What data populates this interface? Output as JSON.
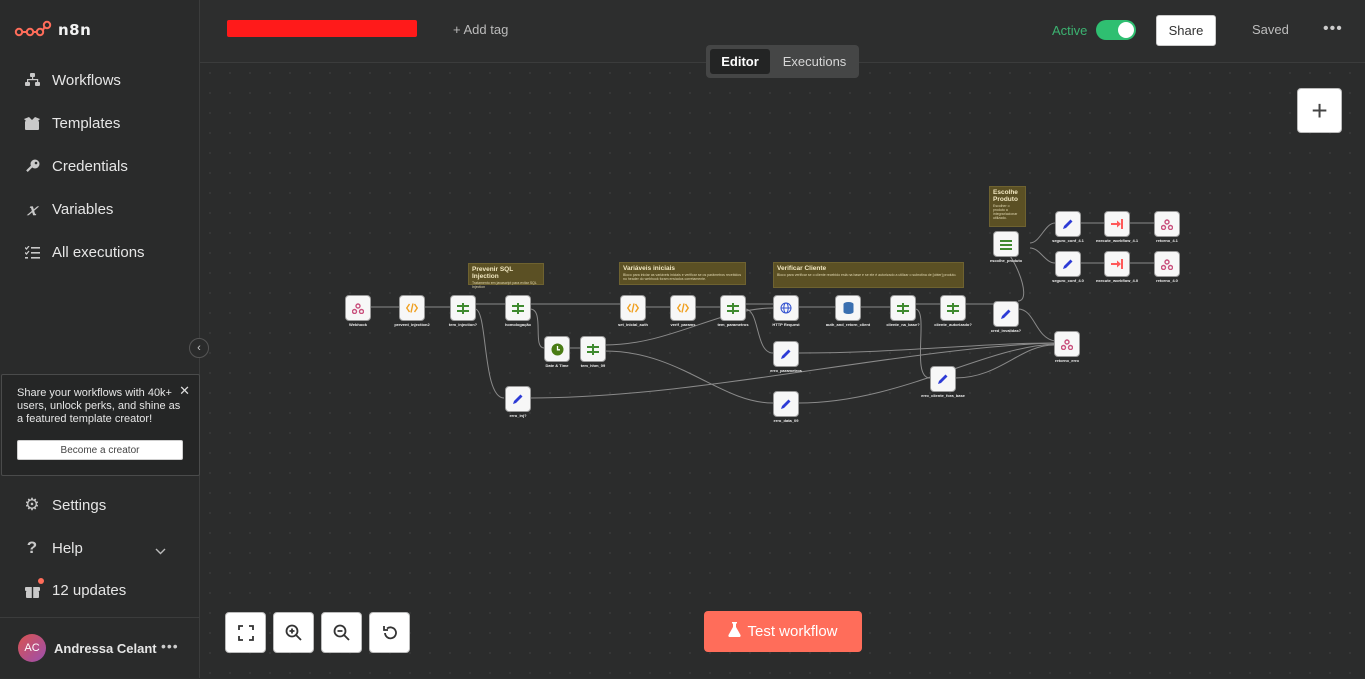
{
  "app": {
    "name": "n8n"
  },
  "sidebar": {
    "items": [
      {
        "label": "Workflows",
        "icon": "workflows-icon"
      },
      {
        "label": "Templates",
        "icon": "templates-icon"
      },
      {
        "label": "Credentials",
        "icon": "key-icon"
      },
      {
        "label": "Variables",
        "icon": "variables-icon"
      },
      {
        "label": "All executions",
        "icon": "list-icon"
      }
    ],
    "promo": {
      "text": "Share your workflows with 40k+ users, unlock perks, and shine as a featured template creator!",
      "button": "Become a creator"
    },
    "bottom": {
      "settings": "Settings",
      "help": "Help",
      "updates": "12 updates"
    },
    "user": {
      "initials": "AC",
      "name": "Andressa Celant"
    }
  },
  "header": {
    "add_tag": "+ Add tag",
    "active_label": "Active",
    "active": true,
    "share": "Share",
    "saved": "Saved",
    "accent_color": "#ff6d5a",
    "active_color": "#2fbf71"
  },
  "tabs": [
    {
      "label": "Editor",
      "selected": true
    },
    {
      "label": "Executions",
      "selected": false
    }
  ],
  "canvas": {
    "test_button": "Test workflow",
    "controls": [
      "fullscreen-icon",
      "zoom-in-icon",
      "zoom-out-icon",
      "reset-icon"
    ],
    "sticky_notes": [
      {
        "title": "Prevenir SQL Injection",
        "desc": "Tratamento em javascript para evitar SQL Injection"
      },
      {
        "title": "Variáveis iniciais",
        "desc": "Bloco para iniciar as variáveis iniciais e verificar se os parâmetros recebidos no header do webhook foram enviados corretamente."
      },
      {
        "title": "Verificar Cliente",
        "desc": "Bloco para verificar se o cliente recebido está na base e se ele é autorizado a utilizar o subrotina de [obter] produto."
      },
      {
        "title": "Escolhe Produto",
        "desc": "Escolher o produto a integrar/acionar utilizado."
      }
    ],
    "nodes": [
      {
        "label": "Webhook",
        "icon": "webhook-icon"
      },
      {
        "label": "prevent_injection2",
        "icon": "code-icon"
      },
      {
        "label": "tem_injection?",
        "icon": "if-icon"
      },
      {
        "label": "homologação",
        "icon": "if-icon"
      },
      {
        "label": "Date & Time",
        "icon": "clock-icon"
      },
      {
        "label": "tem_hhm_09",
        "icon": "if-icon"
      },
      {
        "label": "erro_inj?",
        "icon": "set-icon"
      },
      {
        "label": "set_inicial_auth",
        "icon": "code-icon"
      },
      {
        "label": "verif_params",
        "icon": "code-icon"
      },
      {
        "label": "tem_parametros",
        "icon": "if-icon"
      },
      {
        "label": "HTTP Request",
        "icon": "globe-icon"
      },
      {
        "label": "auth_and_retorn_client",
        "icon": "database-icon"
      },
      {
        "label": "cliente_na_base?",
        "icon": "if-icon"
      },
      {
        "label": "cliente_autorizado?",
        "icon": "if-icon"
      },
      {
        "label": "erro_parametros",
        "icon": "set-icon"
      },
      {
        "label": "erro_data_09",
        "icon": "set-icon"
      },
      {
        "label": "erro_cliente_fora_base",
        "icon": "set-icon"
      },
      {
        "label": "cred_invalidas?",
        "icon": "set-icon"
      },
      {
        "label": "escolhe_produto",
        "icon": "switch-icon"
      },
      {
        "label": "seguro_conf_4.1",
        "icon": "set-icon"
      },
      {
        "label": "execute_workflow_4.1",
        "icon": "execute-icon"
      },
      {
        "label": "retorno_4.1",
        "icon": "webhook-icon"
      },
      {
        "label": "seguro_conf_4.0",
        "icon": "set-icon"
      },
      {
        "label": "execute_workflow_4.0",
        "icon": "execute-icon"
      },
      {
        "label": "retorno_4.0",
        "icon": "webhook-icon"
      },
      {
        "label": "retorno_erro",
        "icon": "webhook-icon"
      }
    ]
  }
}
